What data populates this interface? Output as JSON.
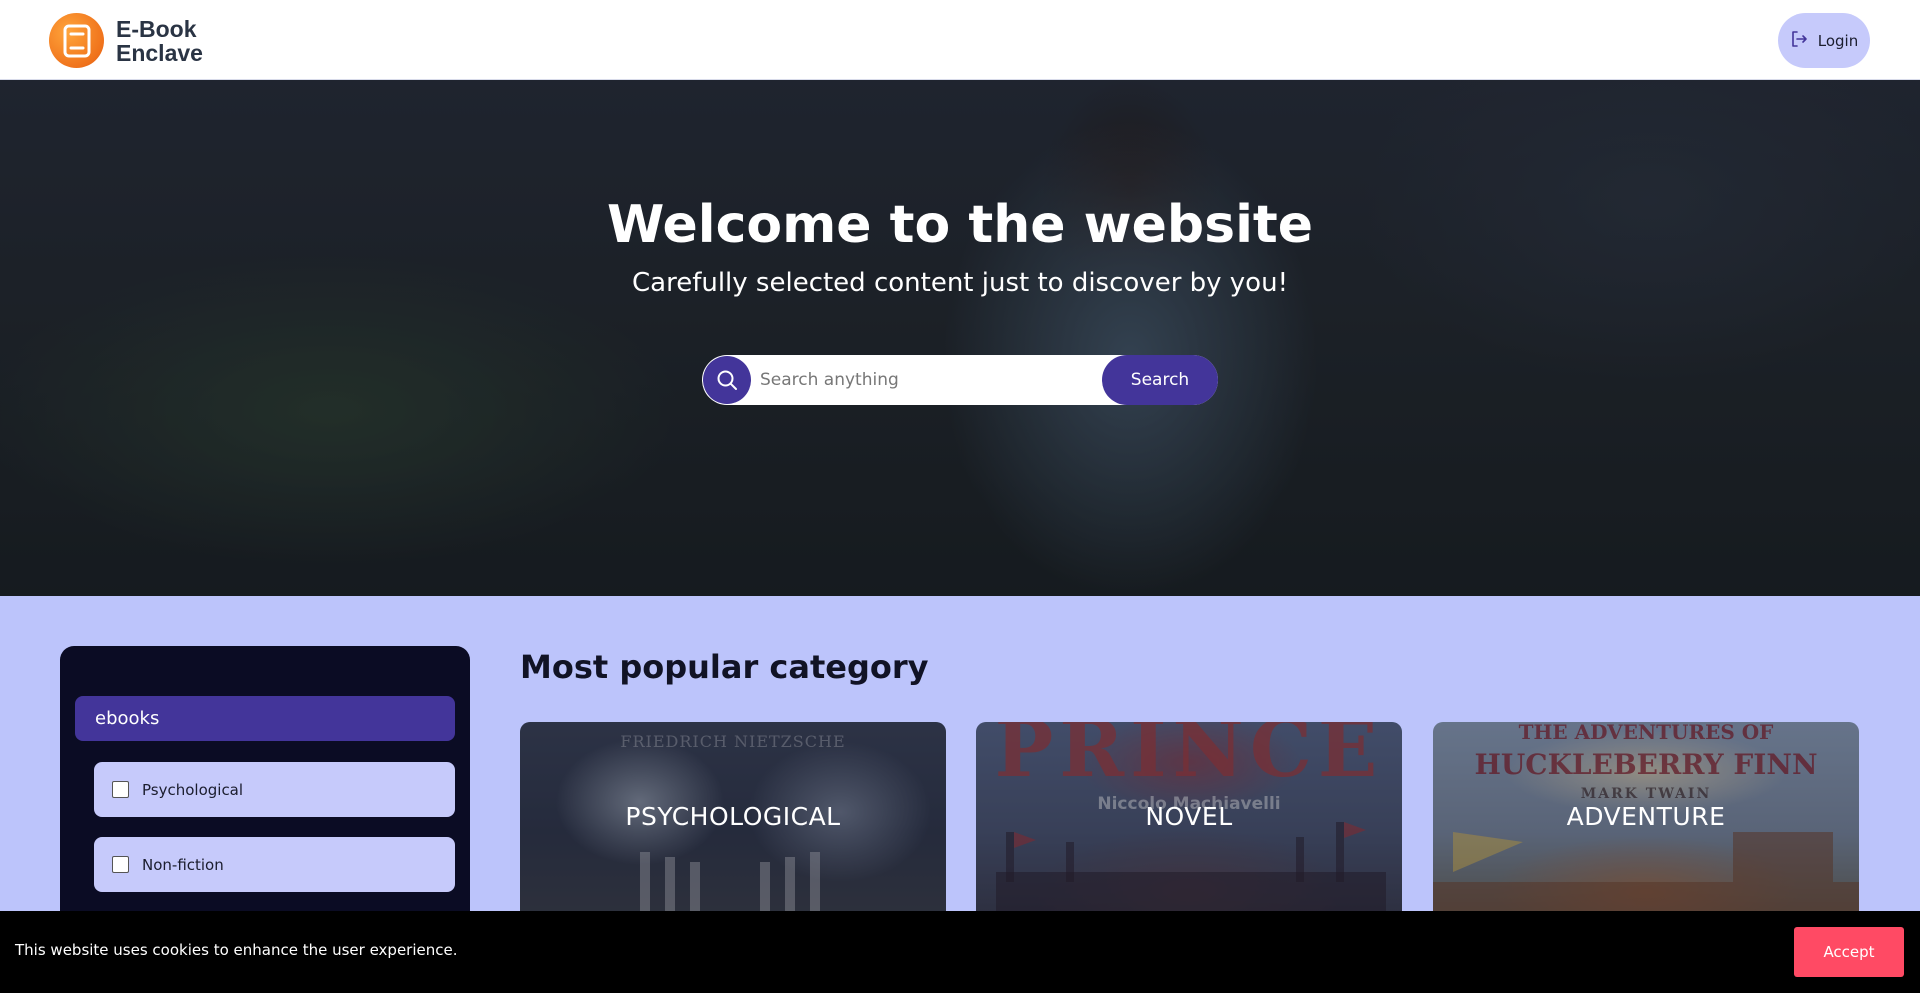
{
  "header": {
    "logo_line1": "E-Book",
    "logo_line2": "Enclave",
    "login_label": "Login",
    "login_icon": "logout-arrow-icon"
  },
  "hero": {
    "title": "Welcome to the website",
    "subtitle": "Carefully selected content just to discover by you!",
    "search_placeholder": "Search anything",
    "search_value": "",
    "search_button": "Search",
    "search_icon": "search-icon"
  },
  "sidebar": {
    "category": "ebooks",
    "filters": [
      {
        "label": "Psychological",
        "checked": false
      },
      {
        "label": "Non-fiction",
        "checked": false
      }
    ]
  },
  "popular": {
    "title": "Most popular category",
    "cards": [
      {
        "label": "PSYCHOLOGICAL",
        "cover_text": "FRIEDRICH NIETZSCHE"
      },
      {
        "label": "NOVEL",
        "cover_title": "PRINCE",
        "cover_author": "Niccolo Machiavelli"
      },
      {
        "label": "ADVENTURE",
        "cover_title_1": "THE ADVENTURES OF",
        "cover_title_2": "HUCKLEBERRY FINN",
        "cover_author": "MARK TWAIN"
      }
    ]
  },
  "cookie": {
    "text": "This website uses cookies to enhance the user experience.",
    "accept": "Accept"
  },
  "colors": {
    "brand": "#43359a",
    "page_background": "#bcc4fb",
    "accent_button": "#ff4a64",
    "logo_orange": "#f0731c"
  }
}
